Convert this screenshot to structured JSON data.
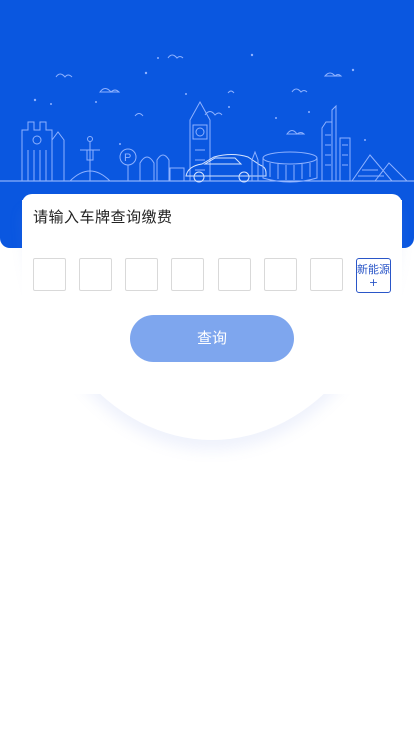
{
  "colors": {
    "hero_blue": "#0a57e0",
    "button_blue": "#7ea6ee",
    "new_energy_border": "#2a56c8"
  },
  "card": {
    "title": "请输入车牌查询缴费"
  },
  "plate": {
    "slots": [
      "",
      "",
      "",
      "",
      "",
      "",
      ""
    ],
    "new_energy_label": "新能源",
    "new_energy_plus": "+"
  },
  "query_button": {
    "label": "查询"
  },
  "hero": {
    "illustration": "city-skyline-with-car-icon",
    "parking_sign_text": "P"
  }
}
